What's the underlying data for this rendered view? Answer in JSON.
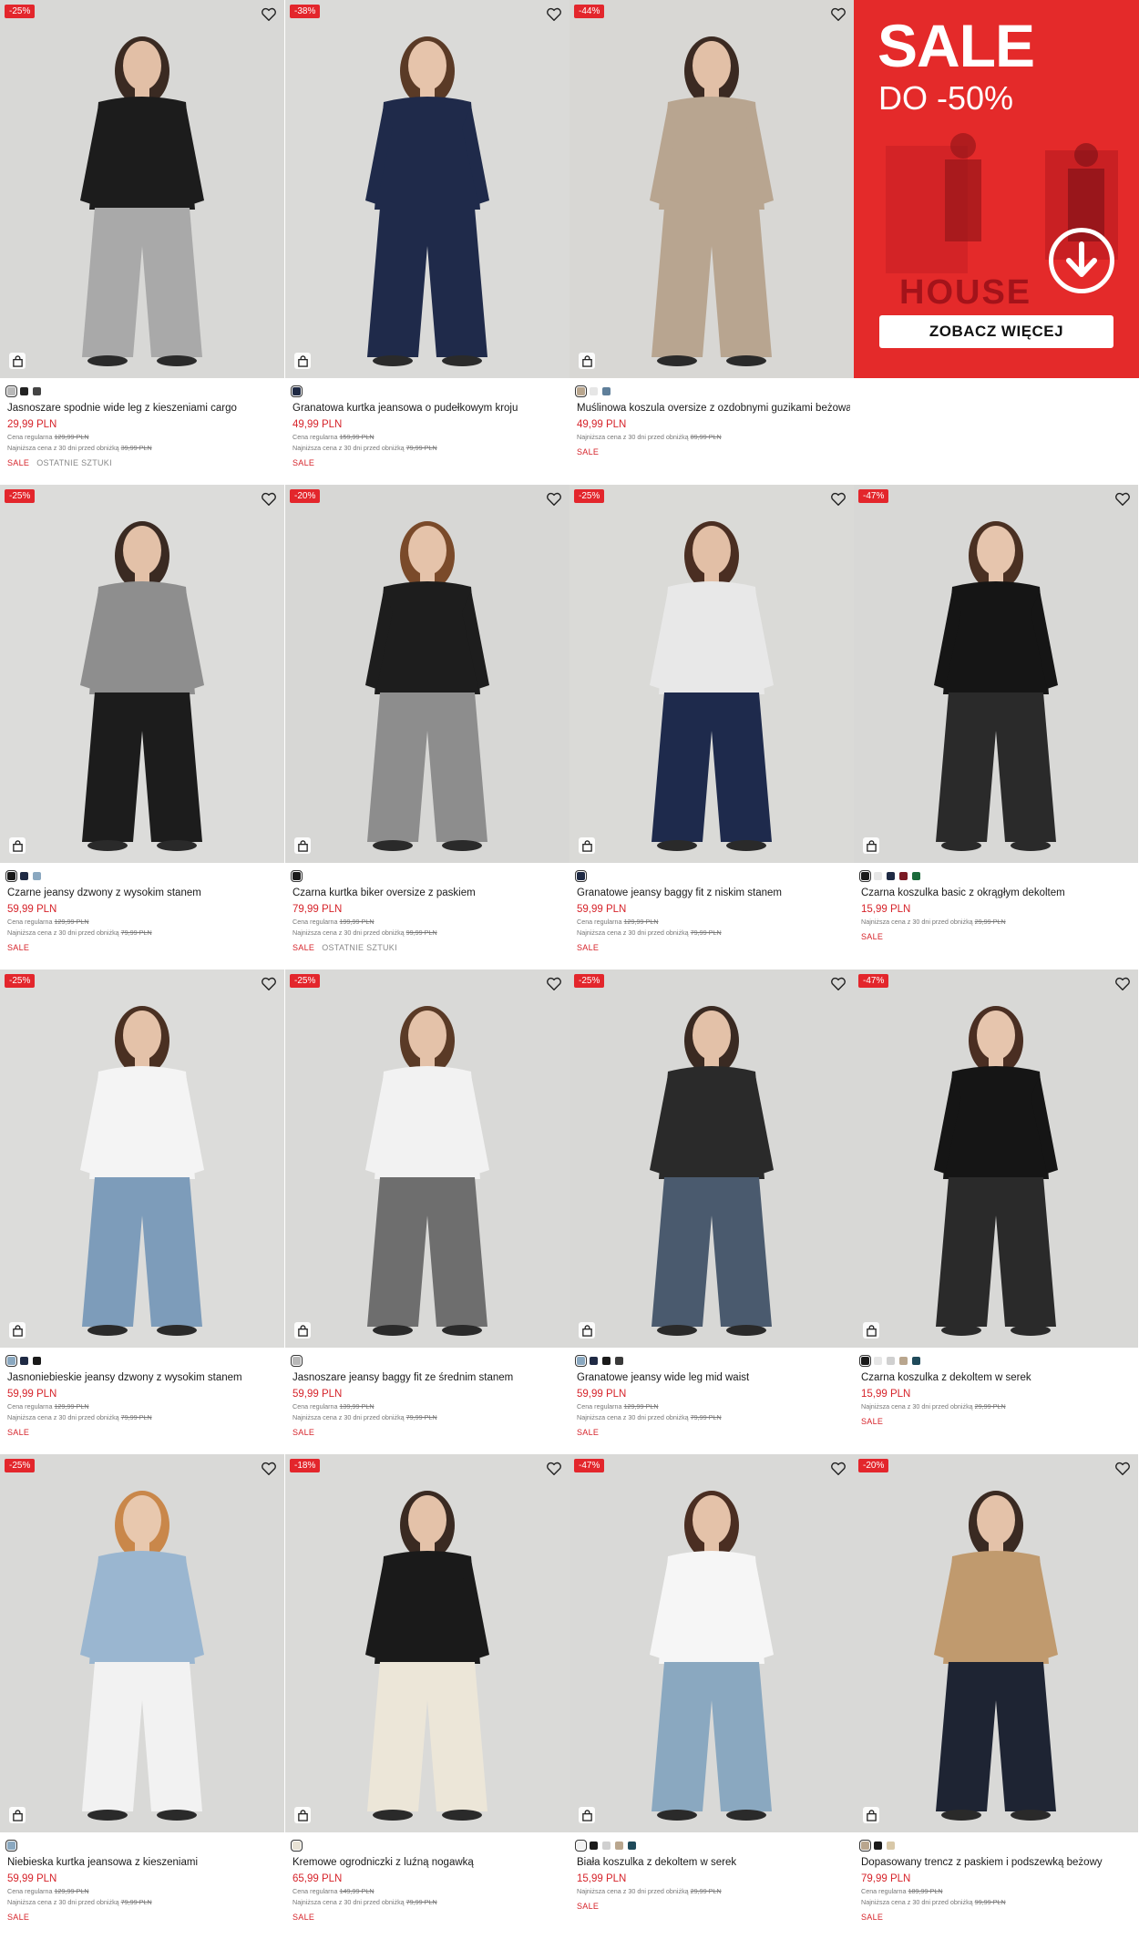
{
  "promo": {
    "title": "SALE",
    "subtitle": "DO -50%",
    "brand": "HOUSE",
    "button_label": "ZOBACZ WIĘCEJ",
    "color": "#e42a2a"
  },
  "colors": {
    "accent": "#d6232a",
    "badge": "#e3262c"
  },
  "labels": {
    "regular_prefix": "Cena regularna",
    "lowest_prefix": "Najniższa cena z 30 dni przed obniżką",
    "sale": "SALE",
    "last_items": "OSTATNIE SZTUKI"
  },
  "products": [
    {
      "badge": "-25%",
      "name": "Jasnoszare spodnie wide leg z kieszeniami cargo",
      "price": "29,99 PLN",
      "regular": "129,99 PLN",
      "lowest": "39,99 PLN",
      "last": true,
      "swatches": [
        "#b8b8b8",
        "#222222",
        "#444444"
      ],
      "bg": "#d8d8d6",
      "top": "#1c1c1c",
      "bottom": "#a9a9a9",
      "skin": "#e2bfa6",
      "hair": "#3a2a22"
    },
    {
      "badge": "-38%",
      "name": "Granatowa kurtka jeansowa o pudełkowym kroju",
      "price": "49,99 PLN",
      "regular": "159,99 PLN",
      "lowest": "79,99 PLN",
      "last": false,
      "swatches": [
        "#1f2a44"
      ],
      "bg": "#dadad8",
      "top": "#1f2a4a",
      "bottom": "#1f2a4a",
      "skin": "#e6c4ab",
      "hair": "#5a3a26"
    },
    {
      "badge": "-44%",
      "name": "Muślinowa koszula oversize z ozdobnymi guzikami beżowa",
      "price": "49,99 PLN",
      "regular": null,
      "lowest": "89,99 PLN",
      "last": false,
      "swatches": [
        "#b9a68e",
        "#e6e6e6",
        "#5f7f9a"
      ],
      "bg": "#d8d7d4",
      "top": "#b8a590",
      "bottom": "#b8a590",
      "skin": "#e2c0a7",
      "hair": "#3b2a22"
    },
    {
      "badge": "-25%",
      "name": "Czarne jeansy dzwony z wysokim stanem",
      "price": "59,99 PLN",
      "regular": "129,99 PLN",
      "lowest": "79,99 PLN",
      "last": false,
      "swatches": [
        "#1a1a1a",
        "#1f2a44",
        "#8aa8c0"
      ],
      "bg": "#dcdcda",
      "top": "#8e8e8e",
      "bottom": "#1c1c1c",
      "skin": "#e3c1a8",
      "hair": "#3a2a22"
    },
    {
      "badge": "-20%",
      "name": "Czarna kurtka biker oversize z paskiem",
      "price": "79,99 PLN",
      "regular": "199,99 PLN",
      "lowest": "99,99 PLN",
      "last": true,
      "swatches": [
        "#1a1a1a"
      ],
      "bg": "#d7d7d5",
      "top": "#1d1d1d",
      "bottom": "#8d8d8d",
      "skin": "#e5c3aa",
      "hair": "#7a4a2a"
    },
    {
      "badge": "-25%",
      "name": "Granatowe jeansy baggy fit z niskim stanem",
      "price": "59,99 PLN",
      "regular": "129,99 PLN",
      "lowest": "79,99 PLN",
      "last": false,
      "swatches": [
        "#1f2a44"
      ],
      "bg": "#dadad7",
      "top": "#e8e8e8",
      "bottom": "#1e2a4c",
      "skin": "#e2bfa6",
      "hair": "#4a2e22"
    },
    {
      "badge": "-47%",
      "name": "Czarna koszulka basic z okrągłym dekoltem",
      "price": "15,99 PLN",
      "regular": null,
      "lowest": "29,99 PLN",
      "last": false,
      "swatches": [
        "#1a1a1a",
        "#e6e6e6",
        "#1f2a44",
        "#7a1a24",
        "#1a6a3a"
      ],
      "bg": "#d8d8d6",
      "top": "#151515",
      "bottom": "#2a2a2a",
      "skin": "#e6c5ad",
      "hair": "#4a3022"
    },
    {
      "badge": "-25%",
      "name": "Jasnoniebieskie jeansy dzwony z wysokim stanem",
      "price": "59,99 PLN",
      "regular": "129,99 PLN",
      "lowest": "79,99 PLN",
      "last": false,
      "swatches": [
        "#8aa8c0",
        "#1f2a44",
        "#1a1a1a"
      ],
      "bg": "#dcdcda",
      "top": "#f4f4f4",
      "bottom": "#7d9cba",
      "skin": "#e4c2a9",
      "hair": "#4a3022"
    },
    {
      "badge": "-25%",
      "name": "Jasnoszare jeansy baggy fit ze średnim stanem",
      "price": "59,99 PLN",
      "regular": "139,99 PLN",
      "lowest": "79,99 PLN",
      "last": false,
      "swatches": [
        "#b8b8b8"
      ],
      "bg": "#d9d9d7",
      "top": "#f2f2f2",
      "bottom": "#6e6e6e",
      "skin": "#e4c2a9",
      "hair": "#5a3a26"
    },
    {
      "badge": "-25%",
      "name": "Granatowe jeansy wide leg mid waist",
      "price": "59,99 PLN",
      "regular": "129,99 PLN",
      "lowest": "79,99 PLN",
      "last": false,
      "swatches": [
        "#8aa8c0",
        "#1f2a44",
        "#1a1a1a",
        "#3a3a3a"
      ],
      "bg": "#d8d8d6",
      "top": "#2a2a2a",
      "bottom": "#4a5a6e",
      "skin": "#e3c1a8",
      "hair": "#3a2a22"
    },
    {
      "badge": "-47%",
      "name": "Czarna koszulka z dekoltem w serek",
      "price": "15,99 PLN",
      "regular": null,
      "lowest": "29,99 PLN",
      "last": false,
      "swatches": [
        "#1a1a1a",
        "#e6e6e6",
        "#d0d0d0",
        "#b9a68e",
        "#1f4a5a"
      ],
      "bg": "#d8d8d6",
      "top": "#151515",
      "bottom": "#2a2a2a",
      "skin": "#e6c5ad",
      "hair": "#4a2e22"
    },
    {
      "badge": "-25%",
      "name": "Niebieska kurtka jeansowa z kieszeniami",
      "price": "59,99 PLN",
      "regular": "129,99 PLN",
      "lowest": "79,99 PLN",
      "last": false,
      "swatches": [
        "#8aa8c0"
      ],
      "bg": "#d9d9d7",
      "top": "#9ab6d0",
      "bottom": "#f2f2f2",
      "skin": "#e8c8ae",
      "hair": "#c9874a"
    },
    {
      "badge": "-18%",
      "name": "Kremowe ogrodniczki z luźną nogawką",
      "price": "65,99 PLN",
      "regular": "149,99 PLN",
      "lowest": "79,99 PLN",
      "last": false,
      "swatches": [
        "#e8e2d4"
      ],
      "bg": "#dadad8",
      "top": "#1a1a1a",
      "bottom": "#ece6d8",
      "skin": "#e4c2a9",
      "hair": "#3a2a22"
    },
    {
      "badge": "-47%",
      "name": "Biała koszulka z dekoltem w serek",
      "price": "15,99 PLN",
      "regular": null,
      "lowest": "29,99 PLN",
      "last": false,
      "swatches": [
        "#f2f2f2",
        "#1a1a1a",
        "#d0d0d0",
        "#b9a68e",
        "#1f4a5a"
      ],
      "bg": "#d9d9d7",
      "top": "#f6f6f6",
      "bottom": "#8aa8c0",
      "skin": "#e4c2a9",
      "hair": "#4a2e22"
    },
    {
      "badge": "-20%",
      "name": "Dopasowany trencz z paskiem i podszewką beżowy",
      "price": "79,99 PLN",
      "regular": "189,99 PLN",
      "lowest": "99,99 PLN",
      "last": false,
      "swatches": [
        "#b9a68e",
        "#1a1a1a",
        "#d8c8a8"
      ],
      "bg": "#d9d9d7",
      "top": "#c09a6e",
      "bottom": "#1e2433",
      "skin": "#e4c2a9",
      "hair": "#3a2a22"
    }
  ]
}
